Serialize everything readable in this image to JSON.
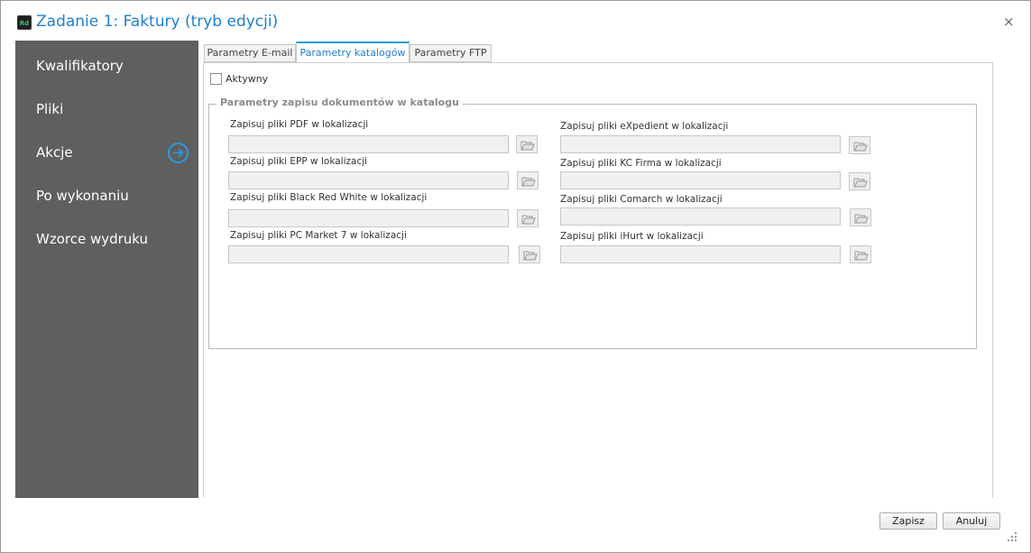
{
  "window": {
    "title": "Zadanie 1: Faktury (tryb edycji)",
    "app_icon_text": "Rd",
    "close_glyph": "×"
  },
  "sidebar": {
    "items": [
      {
        "label": "Kwalifikatory"
      },
      {
        "label": "Pliki"
      },
      {
        "label": "Akcje",
        "active": true
      },
      {
        "label": "Po wykonaniu"
      },
      {
        "label": "Wzorce wydruku"
      }
    ],
    "active_indicator_icon": "arrow-right-circle-icon"
  },
  "tabs": [
    {
      "label": "Parametry E-mail"
    },
    {
      "label": "Parametry katalogów",
      "active": true
    },
    {
      "label": "Parametry FTP"
    }
  ],
  "active_checkbox": {
    "label": "Aktywny",
    "checked": false
  },
  "group": {
    "title": "Parametry zapisu dokumentów w katalogu",
    "left_fields": [
      {
        "label": "Zapisuj pliki PDF w lokalizacji",
        "value": ""
      },
      {
        "label": "Zapisuj pliki EPP w lokalizacji",
        "value": ""
      },
      {
        "label": "Zapisuj pliki Black Red White w lokalizacji",
        "value": ""
      },
      {
        "label": "Zapisuj pliki PC Market 7 w lokalizacji",
        "value": ""
      }
    ],
    "right_fields": [
      {
        "label": "Zapisuj pliki eXpedient w lokalizacji",
        "value": ""
      },
      {
        "label": "Zapisuj pliki KC Firma w lokalizacji",
        "value": ""
      },
      {
        "label": "Zapisuj pliki Comarch w lokalizacji",
        "value": ""
      },
      {
        "label": "Zapisuj pliki iHurt w lokalizacji",
        "value": ""
      }
    ],
    "browse_icon": "folder-open-icon"
  },
  "footer": {
    "save_label": "Zapisz",
    "cancel_label": "Anuluj"
  },
  "colors": {
    "accent": "#1d7fd0",
    "tab_accent": "#2a9be0",
    "sidebar_bg": "#5f5f5f"
  }
}
